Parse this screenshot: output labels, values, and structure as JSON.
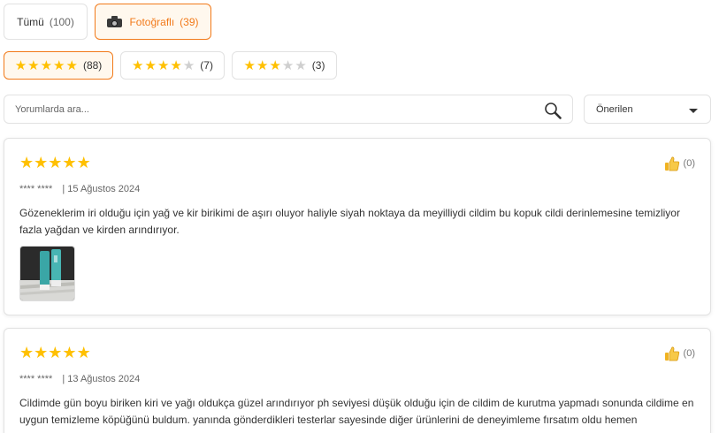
{
  "tabs": [
    {
      "label": "Tümü",
      "count": "(100)"
    },
    {
      "label": "Fotoğraflı",
      "count": "(39)"
    }
  ],
  "star_filters": [
    {
      "stars": 5,
      "count": "(88)"
    },
    {
      "stars": 4,
      "count": "(7)"
    },
    {
      "stars": 3,
      "count": "(3)"
    }
  ],
  "search": {
    "placeholder": "Yorumlarda ara..."
  },
  "sort": {
    "selected": "Önerilen"
  },
  "reviews": [
    {
      "rating": 5,
      "author": "**** ****",
      "date": "| 15 Ağustos 2024",
      "likes": "(0)",
      "text": "Gözeneklerim iri olduğu için yağ ve kir birikimi de aşırı oluyor haliyle siyah noktaya da meyilliydi cildim bu kopuk cildi derinlemesine temizliyor fazla yağdan ve kirden arındırıyor.",
      "has_photo": true
    },
    {
      "rating": 5,
      "author": "**** ****",
      "date": "| 13 Ağustos 2024",
      "likes": "(0)",
      "text": "Cildimde gün boyu biriken kiri ve yağı oldukça güzel arındırıyor ph seviyesi düşük olduğu için de cildim de kurutma yapmadı sonunda cildime en uygun temizleme köpüğünü buldum. yanında gönderdikleri testerlar sayesinde diğer ürünlerini de deneyimleme fırsatım oldu hemen",
      "has_photo": false
    }
  ],
  "colors": {
    "accent": "#f27a1a",
    "star": "#ffc000",
    "border": "#e2e2e2"
  },
  "icons": [
    "camera-icon",
    "star-icon",
    "search-icon",
    "chevron-down-icon",
    "thumbs-up-icon"
  ]
}
